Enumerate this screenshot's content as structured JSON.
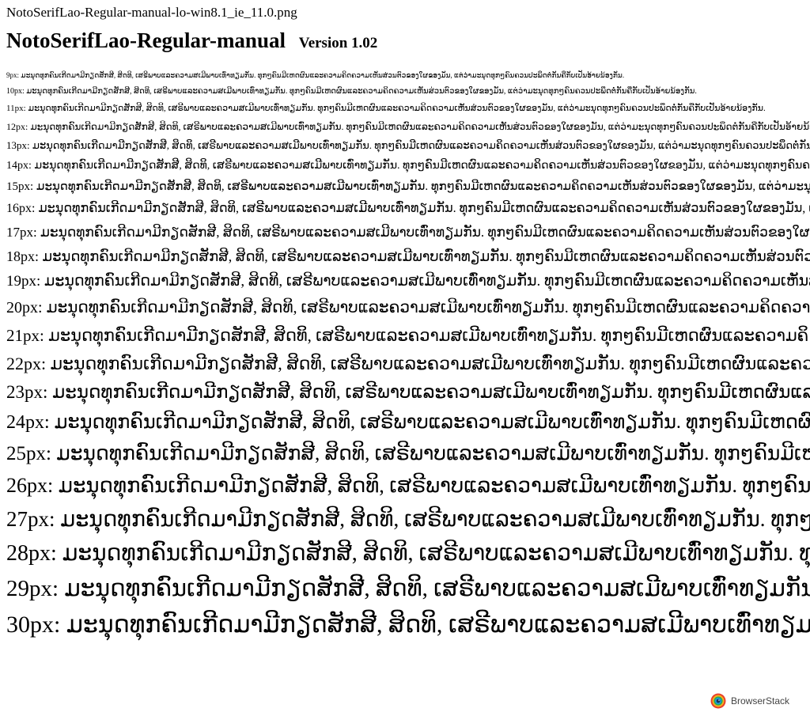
{
  "filename": "NotoSerifLao-Regular-manual-lo-win8.1_ie_11.0.png",
  "heading": {
    "font_name": "NotoSerifLao-Regular-manual",
    "version": "Version 1.02"
  },
  "sample_text": "ມະນຸດທຸກຄົນເກີດມາມີກຽດສັກສີ, ສິດທິ, ເສຣີພາບແລະຄວາມສເມີພາບເທົ່າທຽມກັນ. ທຸກໆຄົນມີເຫດຜົນແລະຄວາມຄິດຄວາມເຫັນສ່ວນຕົວຂອງໃຜຂອງມັນ, ແຕ່ວ່າມະນຸດທຸກໆຄົນຄວນປະພຶດຕໍ່ກັນຄືກັບເປັນອ້າຍນ້ອງກັນ.",
  "samples": [
    {
      "label": "9px:"
    },
    {
      "label": "10px:"
    },
    {
      "label": "11px:"
    },
    {
      "label": "12px:"
    },
    {
      "label": "13px:"
    },
    {
      "label": "14px:"
    },
    {
      "label": "15px:"
    },
    {
      "label": "16px:"
    },
    {
      "label": "17px:"
    },
    {
      "label": "18px:"
    },
    {
      "label": "19px:"
    },
    {
      "label": "20px:"
    },
    {
      "label": "21px:"
    },
    {
      "label": "22px:"
    },
    {
      "label": "23px:"
    },
    {
      "label": "24px:"
    },
    {
      "label": "25px:"
    },
    {
      "label": "26px:"
    },
    {
      "label": "27px:"
    },
    {
      "label": "28px:"
    },
    {
      "label": "29px:"
    },
    {
      "label": "30px:"
    }
  ],
  "badge": {
    "text": "BrowserStack",
    "icon": "browserstack-logo-icon"
  }
}
